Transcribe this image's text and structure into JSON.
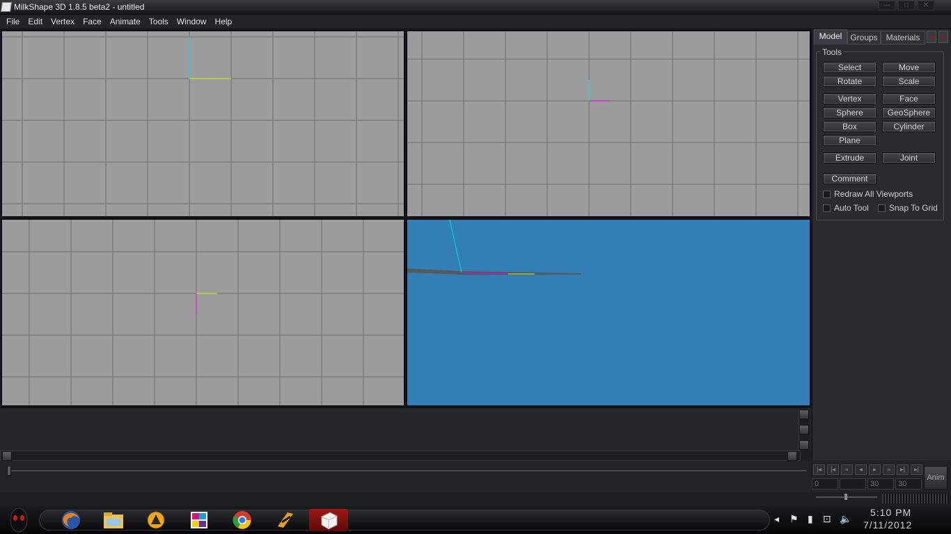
{
  "window": {
    "title": "MilkShape 3D 1.8.5 beta2 - untitled",
    "controls": [
      "—",
      "□",
      "✕"
    ]
  },
  "menu": [
    "File",
    "Edit",
    "Vertex",
    "Face",
    "Animate",
    "Tools",
    "Window",
    "Help"
  ],
  "viewports": {
    "grid_color": "#9c9c9c",
    "grid_line_color": "#6e6e6e",
    "perspective_color": "#337fb5",
    "axis_colors": {
      "cyan": "#00e0e0",
      "yellow": "#e8e800",
      "magenta": "#e000e0"
    }
  },
  "panel": {
    "tabs": [
      "Model",
      "Groups",
      "Materials"
    ],
    "active_tab": "Model",
    "tools_label": "Tools",
    "buttons": {
      "select": "Select",
      "move": "Move",
      "rotate": "Rotate",
      "scale": "Scale",
      "vertex": "Vertex",
      "face": "Face",
      "sphere": "Sphere",
      "geosphere": "GeoSphere",
      "box": "Box",
      "cylinder": "Cylinder",
      "plane": "Plane",
      "extrude": "Extrude",
      "joint": "Joint",
      "comment": "Comment"
    },
    "checkboxes": {
      "redraw": "Redraw All Viewports",
      "auto_tool": "Auto Tool",
      "snap_grid": "Snap To Grid"
    }
  },
  "animation": {
    "fields": [
      "0",
      "",
      "30",
      "30"
    ],
    "anim_button": "Anim"
  },
  "taskbar": {
    "time": "5:10 PM",
    "date": "7/11/2012",
    "apps": [
      "firefox-icon",
      "file-explorer-icon",
      "aimp-icon",
      "paint-icon",
      "chrome-icon",
      "winamp-icon",
      "milkshape-icon"
    ]
  }
}
